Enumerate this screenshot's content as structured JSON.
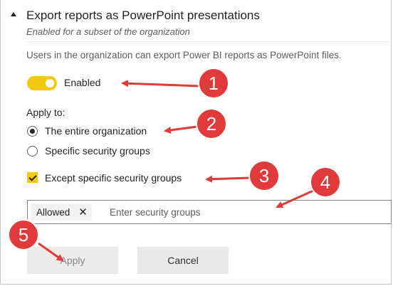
{
  "section": {
    "title": "Export reports as PowerPoint presentations",
    "subtitle": "Enabled for a subset of the organization",
    "description": "Users in the organization can export Power BI reports as PowerPoint files."
  },
  "toggle": {
    "label": "Enabled",
    "on": true
  },
  "apply_to": {
    "label": "Apply to:",
    "options": [
      {
        "label": "The entire organization",
        "selected": true
      },
      {
        "label": "Specific security groups",
        "selected": false
      }
    ]
  },
  "except": {
    "label": "Except specific security groups",
    "checked": true
  },
  "security_groups": {
    "chips": [
      {
        "label": "Allowed",
        "remove": "✕"
      }
    ],
    "placeholder": "Enter security groups"
  },
  "buttons": {
    "apply": "Apply",
    "cancel": "Cancel"
  },
  "callouts": [
    "1",
    "2",
    "3",
    "4",
    "5"
  ],
  "colors": {
    "accent": "#f2c811",
    "callout": "#e03a3a",
    "arrow": "#e03a3a"
  }
}
